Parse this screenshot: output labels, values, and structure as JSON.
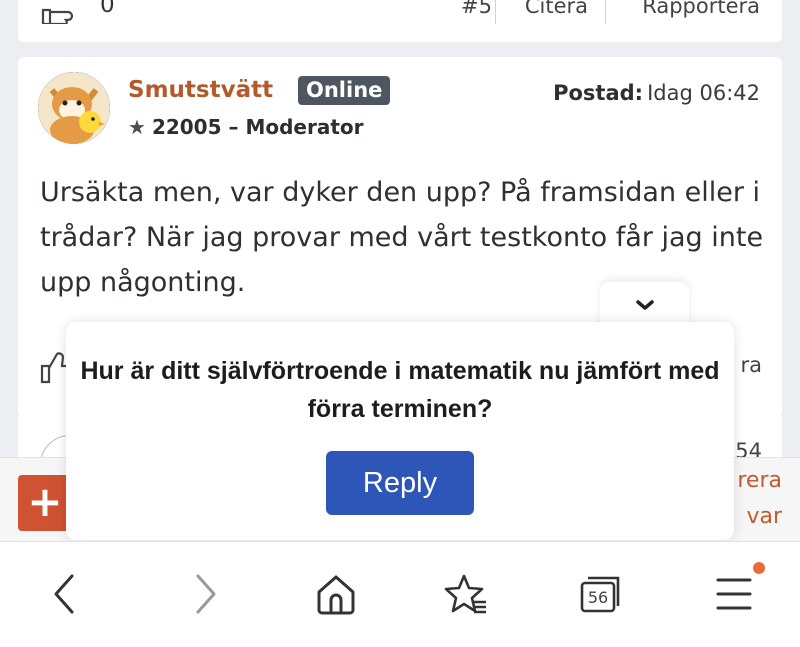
{
  "previous_post": {
    "like_count": "0",
    "post_number": "#5",
    "quote_label": "Citera",
    "report_label": "Rapportera"
  },
  "post": {
    "username": "Smutstvätt",
    "online_badge": "Online",
    "rank": "22005 – Moderator",
    "posted_label": "Postad:",
    "posted_time": "Idag 06:42",
    "body": "Ursäkta men, var dyker den upp? På framsidan eller i trådar? När jag provar med vårt testkonto får jag inte upp någonting.",
    "footer_right_partial": "ra"
  },
  "next_post": {
    "post_number_partial": "54"
  },
  "action_bar": {
    "line1_partial": "rera",
    "line2_partial": "var"
  },
  "popup": {
    "question": "Hur är ditt självförtroende i matematik nu jämfört med förra terminen?",
    "reply_label": "Reply"
  },
  "browser": {
    "tab_count": "56"
  },
  "colors": {
    "username": "#b35a2c",
    "reply_button": "#2e55b8",
    "add_button": "#cf5232",
    "notification_dot": "#e86c34"
  }
}
